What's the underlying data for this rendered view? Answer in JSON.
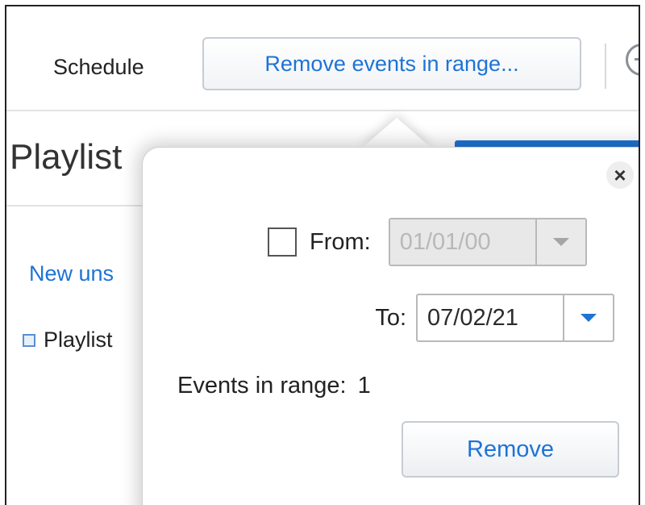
{
  "toolbar": {
    "section_label": "Schedule",
    "range_button_label": "Remove events in range..."
  },
  "background": {
    "title": "Playlist",
    "link": "New uns",
    "list_item": "Playlist"
  },
  "popup": {
    "close_glyph": "×",
    "from": {
      "label": "From:",
      "checked": false,
      "value": "01/01/00",
      "enabled": false
    },
    "to": {
      "label": "To:",
      "value": "07/02/21",
      "enabled": true
    },
    "events_label": "Events in range:",
    "events_count": "1",
    "remove_label": "Remove"
  },
  "colors": {
    "accent": "#1e73d6",
    "border": "#c7ccd3"
  },
  "icons": {
    "toolbar_right": "minus-circle-icon",
    "from_dropdown": "chevron-down-icon",
    "to_dropdown": "chevron-down-icon"
  }
}
